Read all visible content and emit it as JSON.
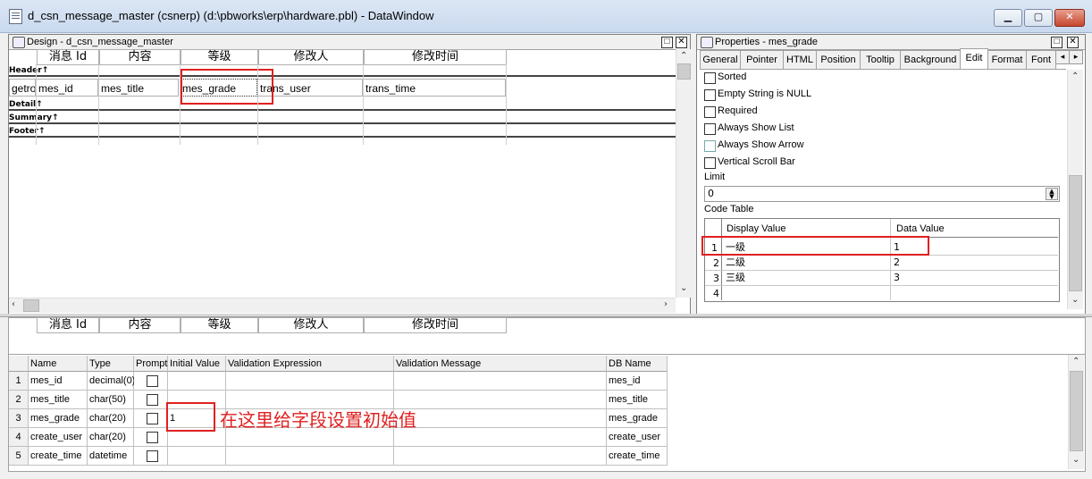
{
  "window": {
    "title": "d_csn_message_master  (csnerp) (d:\\pbworks\\erp\\hardware.pbl) - DataWindow",
    "minimize": "▁",
    "maximize": "▢",
    "close": "✕"
  },
  "design_pane": {
    "title": "Design - d_csn_message_master",
    "headers": [
      "消息 Id",
      "内容",
      "等级",
      "修改人",
      "修改时间"
    ],
    "bands": [
      "Header↑",
      "Detail↑",
      "Summary↑",
      "Footer↑"
    ],
    "detail_fields": [
      "getro",
      "mes_id",
      "mes_title",
      "mes_grade",
      "trans_user",
      "trans_time"
    ]
  },
  "preview_pane": {
    "headers": [
      "消息 Id",
      "内容",
      "等级",
      "修改人",
      "修改时间"
    ]
  },
  "properties_pane": {
    "title": "Properties - mes_grade",
    "tabs": [
      "General",
      "Pointer",
      "HTML",
      "Position",
      "Tooltip",
      "Background",
      "Edit",
      "Format",
      "Font"
    ],
    "active_tab": "Edit",
    "checkboxes": [
      "Sorted",
      "Empty String is NULL",
      "Required",
      "Always Show List",
      "Always Show Arrow",
      "Vertical Scroll Bar"
    ],
    "limit_label": "Limit",
    "limit_value": "0",
    "code_table_label": "Code Table",
    "code_table": {
      "headers": [
        "Display Value",
        "Data Value"
      ],
      "rows": [
        {
          "num": "1",
          "display": "一级",
          "data": "1"
        },
        {
          "num": "2",
          "display": "二级",
          "data": "2"
        },
        {
          "num": "3",
          "display": "三级",
          "data": "3"
        },
        {
          "num": "4",
          "display": "",
          "data": ""
        }
      ]
    }
  },
  "column_spec": {
    "headers": [
      "Name",
      "Type",
      "Prompt",
      "Initial Value",
      "Validation Expression",
      "Validation Message",
      "DB Name"
    ],
    "rows": [
      {
        "num": "1",
        "name": "mes_id",
        "type": "decimal(0)",
        "initial": "",
        "db": "mes_id"
      },
      {
        "num": "2",
        "name": "mes_title",
        "type": "char(50)",
        "initial": "",
        "db": "mes_title"
      },
      {
        "num": "3",
        "name": "mes_grade",
        "type": "char(20)",
        "initial": "1",
        "db": "mes_grade"
      },
      {
        "num": "4",
        "name": "create_user",
        "type": "char(20)",
        "initial": "",
        "db": "create_user"
      },
      {
        "num": "5",
        "name": "create_time",
        "type": "datetime",
        "initial": "",
        "db": "create_time"
      }
    ]
  },
  "annotation": "在这里给字段设置初始值"
}
